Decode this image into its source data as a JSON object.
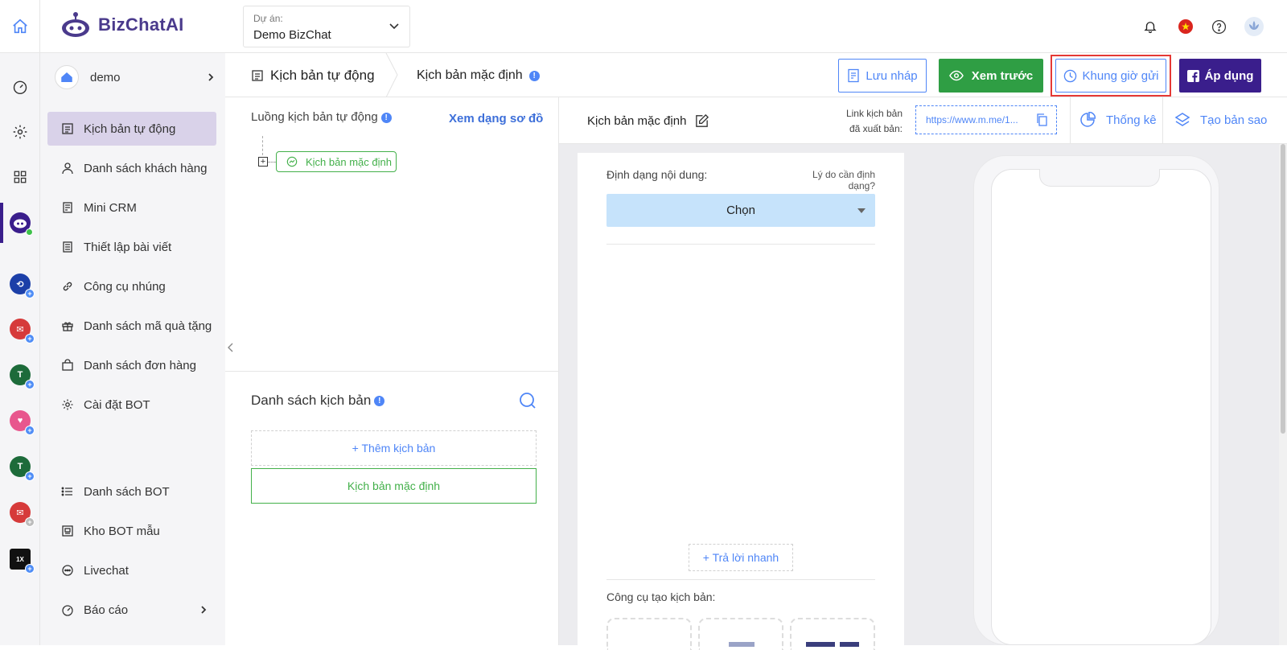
{
  "brand": {
    "logo_text": "BizChatAI"
  },
  "project": {
    "label": "Dự án:",
    "value": "Demo BizChat"
  },
  "user": {
    "name": "demo"
  },
  "nav": {
    "items": [
      {
        "label": "Kịch bản tự động",
        "icon": "script-icon"
      },
      {
        "label": "Danh sách khách hàng",
        "icon": "user-icon"
      },
      {
        "label": "Mini CRM",
        "icon": "crm-icon"
      },
      {
        "label": "Thiết lập bài viết",
        "icon": "post-icon"
      },
      {
        "label": "Công cụ nhúng",
        "icon": "link-icon"
      },
      {
        "label": "Danh sách mã quà tặng",
        "icon": "gift-icon"
      },
      {
        "label": "Danh sách đơn hàng",
        "icon": "bag-icon"
      },
      {
        "label": "Cài đặt BOT",
        "icon": "gear-icon"
      },
      {
        "label": "Danh sách BOT",
        "icon": "list-icon"
      },
      {
        "label": "Kho BOT mẫu",
        "icon": "template-icon"
      },
      {
        "label": "Livechat",
        "icon": "chat-icon"
      },
      {
        "label": "Báo cáo",
        "icon": "report-icon"
      }
    ]
  },
  "header": {
    "breadcrumb_1": "Kịch bản tự động",
    "breadcrumb_2": "Kịch bản mặc định",
    "draft_label": "Lưu nháp",
    "preview_label": "Xem trước",
    "schedule_label": "Khung giờ gửi",
    "apply_label": "Áp dụng"
  },
  "flow": {
    "title": "Luồng kịch bản tự động",
    "diagram_link": "Xem dạng sơ đồ",
    "node_label": "Kịch bản mặc định"
  },
  "script_list": {
    "title": "Danh sách kịch bản",
    "add_label": "+ Thêm kịch bản",
    "items": [
      "Kịch bản mặc định"
    ]
  },
  "editor": {
    "script_name": "Kịch bản mặc định",
    "link_label_1": "Link kịch bản",
    "link_label_2": "đã xuất bản:",
    "link_value": "https://www.m.me/1...",
    "stats_label": "Thống kê",
    "copy_label": "Tạo bản sao",
    "format_label": "Định dạng nội dung:",
    "format_why": "Lý do cần định dạng?",
    "select_value": "Chọn",
    "quick_reply": "+ Trả lời nhanh",
    "tools_label": "Công cụ tạo kịch bản:"
  },
  "colors": {
    "accent_purple": "#3a1e8c",
    "green": "#2f9e44",
    "blue": "#4f86f7",
    "highlight_red": "#e53935",
    "select_bg": "#c6e3fb"
  }
}
